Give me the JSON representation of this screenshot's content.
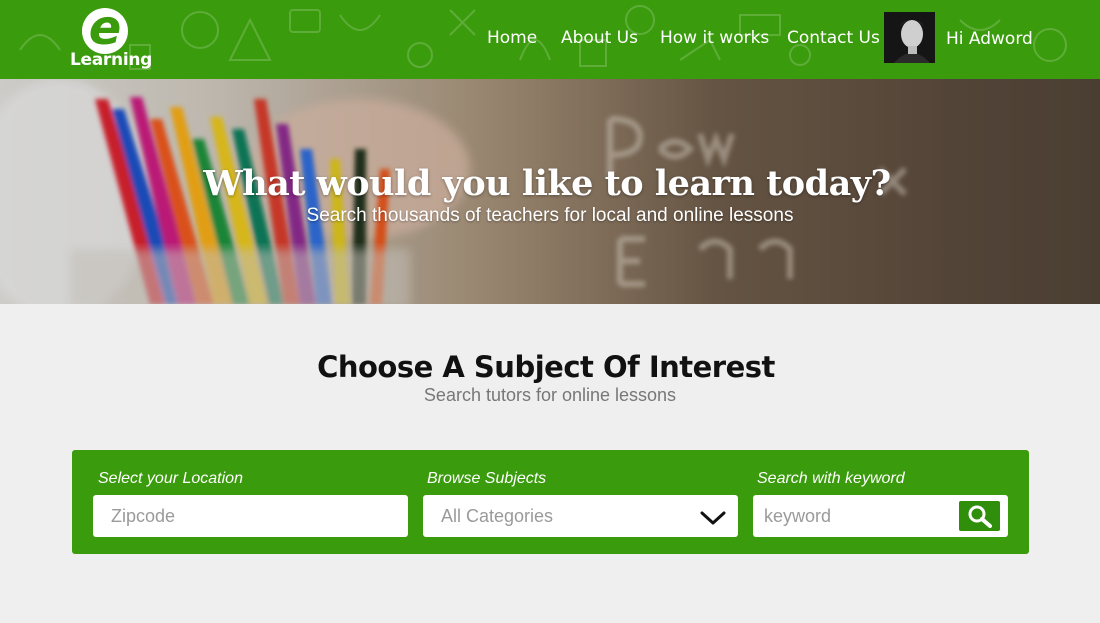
{
  "header": {
    "logo_text": "Learning",
    "logo_letter": "e",
    "nav": [
      {
        "label": "Home"
      },
      {
        "label": "About Us"
      },
      {
        "label": "How it works"
      },
      {
        "label": "Contact Us"
      }
    ],
    "greeting": "Hi Adword",
    "brand_color": "#3a9b0d"
  },
  "hero": {
    "title": "What would you like to learn today?",
    "subtitle": "Search thousands of teachers for local and online lessons"
  },
  "subjects": {
    "title": "Choose A Subject Of Interest",
    "subtitle": "Search tutors for online lessons"
  },
  "search": {
    "location_label": "Select your Location",
    "location_placeholder": "Zipcode",
    "subjects_label": "Browse Subjects",
    "subjects_value": "All Categories",
    "keyword_label": "Search with keyword",
    "keyword_placeholder": "keyword",
    "button_icon": "search-icon"
  }
}
